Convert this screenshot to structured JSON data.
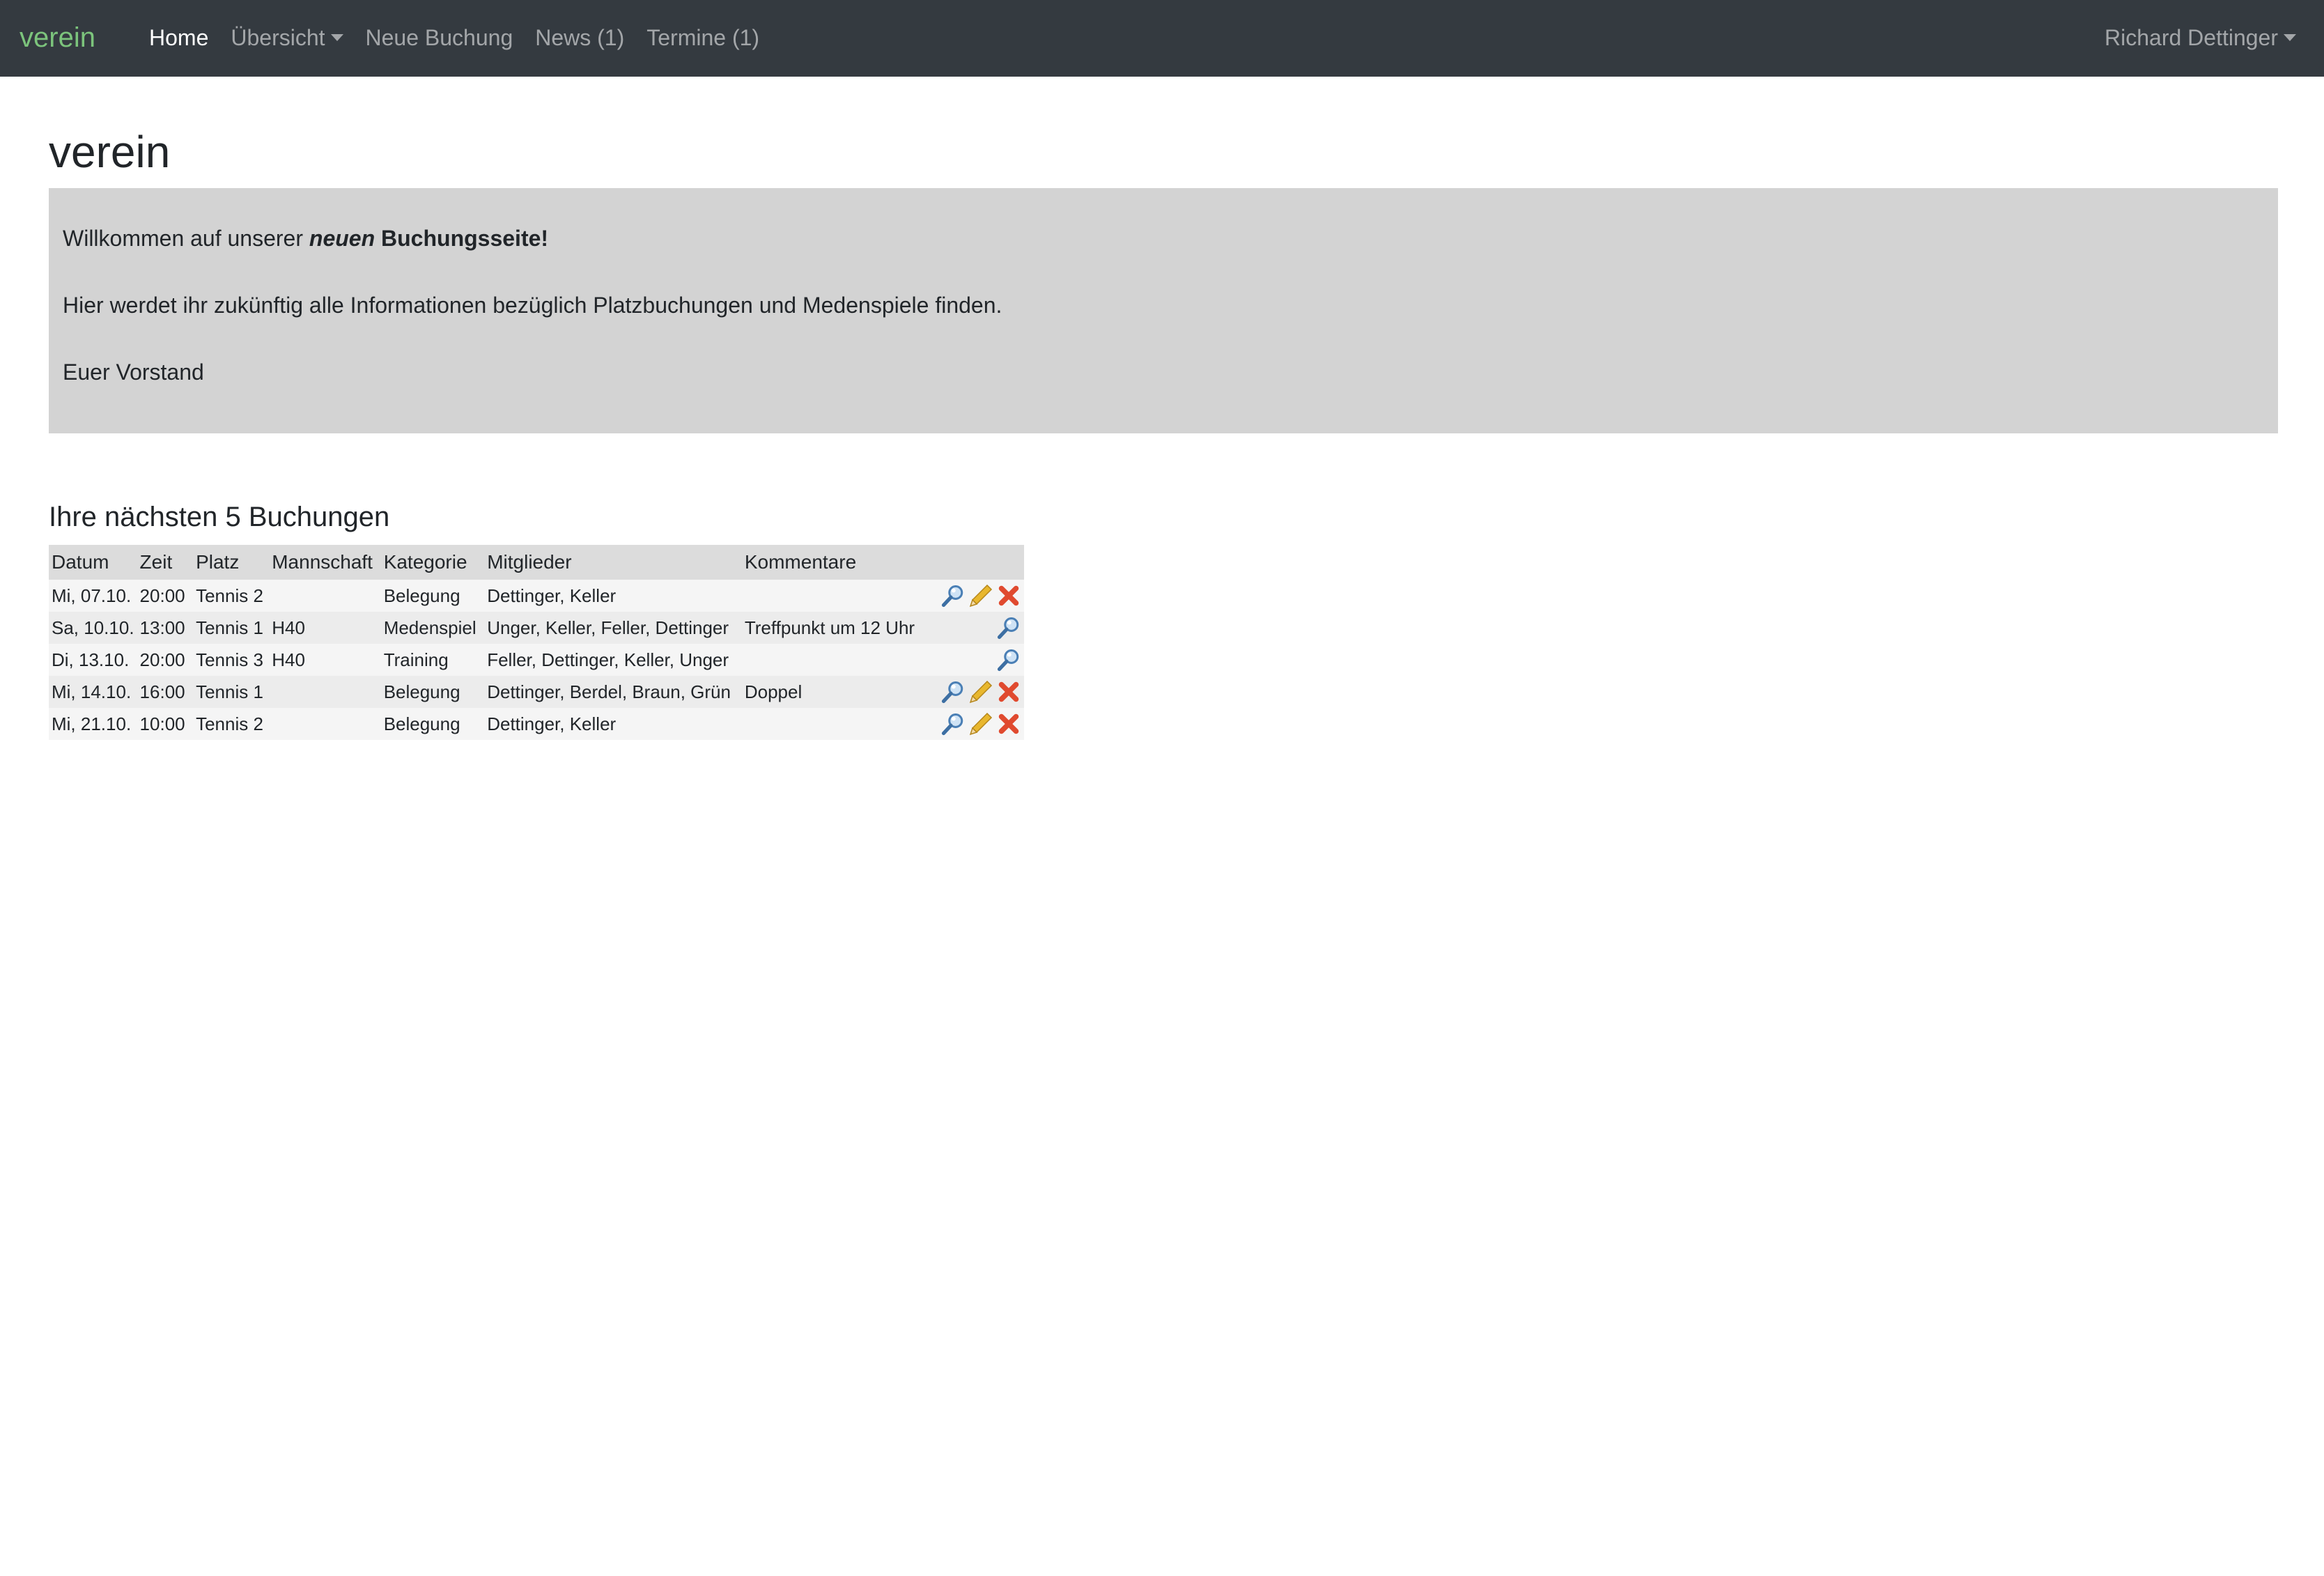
{
  "navbar": {
    "brand": "verein",
    "items": [
      {
        "label": "Home",
        "active": true
      },
      {
        "label": "Übersicht",
        "dropdown": true
      },
      {
        "label": "Neue Buchung"
      },
      {
        "label": "News (1)"
      },
      {
        "label": "Termine (1)"
      }
    ],
    "user": "Richard Dettinger"
  },
  "page": {
    "title": "verein"
  },
  "welcome": {
    "line1_prefix": "Willkommen auf unserer ",
    "line1_em": "neuen",
    "line1_bold": " Buchungsseite!",
    "line2": "Hier werdet ihr zukünftig alle Informationen bezüglich Platzbuchungen und Medenspiele finden.",
    "line3": "Euer Vorstand"
  },
  "bookings": {
    "title": "Ihre nächsten 5 Buchungen",
    "columns": [
      "Datum",
      "Zeit",
      "Platz",
      "Mannschaft",
      "Kategorie",
      "Mitglieder",
      "Kommentare"
    ],
    "rows": [
      {
        "datum": "Mi, 07.10.",
        "zeit": "20:00",
        "platz": "Tennis 2",
        "mannschaft": "",
        "kategorie": "Belegung",
        "mitglieder": "Dettinger, Keller",
        "kommentare": "",
        "actions": [
          "view",
          "edit",
          "delete"
        ]
      },
      {
        "datum": "Sa, 10.10.",
        "zeit": "13:00",
        "platz": "Tennis 1",
        "mannschaft": "H40",
        "kategorie": "Medenspiel",
        "mitglieder": "Unger, Keller, Feller, Dettinger",
        "kommentare": "Treffpunkt um 12 Uhr",
        "actions": [
          "view"
        ]
      },
      {
        "datum": "Di, 13.10.",
        "zeit": "20:00",
        "platz": "Tennis 3",
        "mannschaft": "H40",
        "kategorie": "Training",
        "mitglieder": "Feller, Dettinger, Keller, Unger",
        "kommentare": "",
        "actions": [
          "view"
        ]
      },
      {
        "datum": "Mi, 14.10.",
        "zeit": "16:00",
        "platz": "Tennis 1",
        "mannschaft": "",
        "kategorie": "Belegung",
        "mitglieder": "Dettinger, Berdel, Braun, Grün",
        "kommentare": "Doppel",
        "actions": [
          "view",
          "edit",
          "delete"
        ]
      },
      {
        "datum": "Mi, 21.10.",
        "zeit": "10:00",
        "platz": "Tennis 2",
        "mannschaft": "",
        "kategorie": "Belegung",
        "mitglieder": "Dettinger, Keller",
        "kommentare": "",
        "actions": [
          "view",
          "edit",
          "delete"
        ]
      }
    ]
  },
  "icons": {
    "view": "magnifier-icon",
    "edit": "pencil-icon",
    "delete": "delete-x-icon"
  },
  "colors": {
    "navbar_bg": "#343a40",
    "brand": "#7cc47c",
    "welcome_bg": "#d3d3d3",
    "delete": "#e04a2f",
    "edit": "#e8b72e"
  }
}
